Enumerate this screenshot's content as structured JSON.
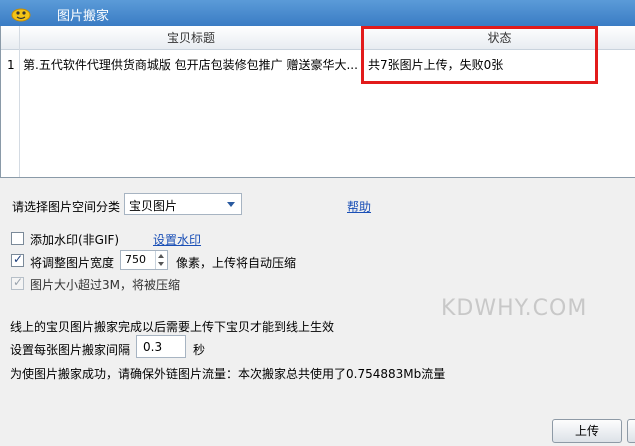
{
  "window": {
    "title": "图片搬家"
  },
  "grid": {
    "columns": [
      "宝贝标题",
      "状态"
    ],
    "rows": [
      {
        "index": "1",
        "title": "第.五代软件代理供货商城版 包开店包装修包推广 赠送豪华大...",
        "status": "共7张图片上传，失败0张"
      }
    ]
  },
  "form": {
    "category_label": "请选择图片空间分类",
    "category_value": "宝贝图片",
    "help_link": "帮助",
    "watermark_checkbox_label": "添加水印(非GIF)",
    "watermark_checked": false,
    "watermark_link": "设置水印",
    "resize_label": "将调整图片宽度",
    "resize_checked": true,
    "resize_width": "750",
    "resize_suffix": "像素，上传将自动压缩",
    "compress_label": "图片大小超过3M，将被压缩",
    "compress_checked": true,
    "note_text": "线上的宝贝图片搬家完成以后需要上传下宝贝才能到线上生效",
    "interval_label": "设置每张图片搬家间隔",
    "interval_value": "0.3",
    "interval_unit": "秒",
    "traffic_note": "为使图片搬家成功，请确保外链图片流量：本次搬家总共使用了0.754883Mb流量"
  },
  "watermark_text": "KDWHY.COM",
  "buttons": {
    "upload": "上传"
  },
  "colors": {
    "title_bar": "#3a7cc4",
    "highlight": "#e21b1b",
    "link": "#1a4fb6"
  },
  "icons": {
    "app": "qianniu-logo-icon"
  }
}
